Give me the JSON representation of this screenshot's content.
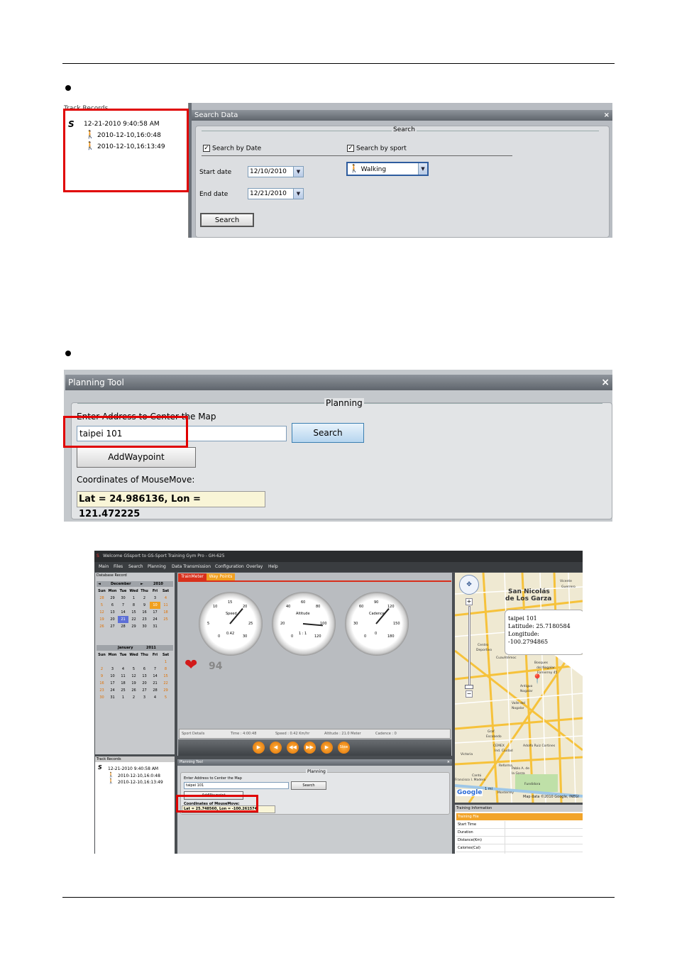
{
  "search_panel": {
    "track_records_title": "Track Records",
    "track_root": "12-21-2010 9:40:58 AM",
    "track_children": [
      "2010-12-10,16:0:48",
      "2010-12-10,16:13:49"
    ],
    "title": "Search Data",
    "close": "×",
    "group_label": "Search",
    "search_by_date": "Search by Date",
    "search_by_sport": "Search by sport",
    "start_date_label": "Start date",
    "start_date_value": "12/10/2010",
    "end_date_label": "End date",
    "end_date_value": "12/21/2010",
    "sport_value": "Walking",
    "search_button": "Search"
  },
  "planning_panel": {
    "title": "Planning Tool",
    "close": "×",
    "group_label": "Planning",
    "address_label": "Enter Address to Center the Map",
    "address_value": "taipei 101",
    "search_button": "Search",
    "add_waypoint": "AddWaypoint",
    "coords_label": "Coordinates of MouseMove:",
    "coords_value": "Lat = 24.986136, Lon = 121.472225"
  },
  "app": {
    "title": "Welcome GSsport to GS-Sport Training Gym Pro - GH-625",
    "menu": [
      "Main",
      "Files",
      "Search",
      "Planning",
      "Data Transmission",
      "Configuration",
      "Overlay",
      "Help"
    ],
    "db_record": "Database Record",
    "cal1_month": "December",
    "cal1_year": "2010",
    "cal2_month": "January",
    "cal2_year": "2011",
    "weekdays": [
      "Sun",
      "Mon",
      "Tue",
      "Wed",
      "Thu",
      "Fri",
      "Sat"
    ],
    "cal1_rows": [
      [
        "28",
        "29",
        "30",
        "1",
        "2",
        "3",
        "4"
      ],
      [
        "5",
        "6",
        "7",
        "8",
        "9",
        "10",
        "11"
      ],
      [
        "12",
        "13",
        "14",
        "15",
        "16",
        "17",
        "18"
      ],
      [
        "19",
        "20",
        "21",
        "22",
        "23",
        "24",
        "25"
      ],
      [
        "26",
        "27",
        "28",
        "29",
        "30",
        "31",
        ""
      ]
    ],
    "cal2_rows": [
      [
        "",
        "",
        "",
        "",
        "",
        "",
        "1"
      ],
      [
        "2",
        "3",
        "4",
        "5",
        "6",
        "7",
        "8"
      ],
      [
        "9",
        "10",
        "11",
        "12",
        "13",
        "14",
        "15"
      ],
      [
        "16",
        "17",
        "18",
        "19",
        "20",
        "21",
        "22"
      ],
      [
        "23",
        "24",
        "25",
        "26",
        "27",
        "28",
        "29"
      ],
      [
        "30",
        "31",
        "1",
        "2",
        "3",
        "4",
        "5"
      ]
    ],
    "tabs": [
      "TrainMeter",
      "Way Points"
    ],
    "gauges": [
      {
        "label": "Speed",
        "value": "0.42",
        "ticks": [
          "0",
          "5",
          "10",
          "15",
          "20",
          "25",
          "30"
        ]
      },
      {
        "label": "Altitude",
        "value": "1 : 1",
        "ticks": [
          "0",
          "20",
          "40",
          "60",
          "80",
          "100",
          "120"
        ]
      },
      {
        "label": "Cadence",
        "value": "0",
        "ticks": [
          "0",
          "30",
          "60",
          "90",
          "120",
          "150",
          "180"
        ]
      }
    ],
    "heart_value": "94",
    "status": [
      "Sport Details",
      "Time : 4:00:48",
      "Speed : 0.42 Km/hr",
      "Altitude : 21.0 Meter",
      "Cadence : 0"
    ],
    "slow_btn": "Slow",
    "track_records": "Track Records",
    "track_root": "12-21-2010 9:40:58 AM",
    "track_children": [
      "2010-12-10,16:0:48",
      "2010-12-10,16:13:49"
    ],
    "plan_title": "Planning Tool",
    "plan_group": "Planning",
    "plan_address_label": "Enter Address to Center the Map",
    "plan_address": "taipei 101",
    "plan_search": "Search",
    "plan_add": "AddWaypoint",
    "plan_coords_label": "Coordinates of MouseMove:",
    "plan_coords": "Lat = 25.748560, Lon = -100.261574",
    "map": {
      "city": "San Nicolás",
      "city2": "de Los Garza",
      "info_title": "taipei 101",
      "info_lat": "Latitude: 25.7180584",
      "info_lon": "Longitude: -100.2794865",
      "labels": [
        "Vicente",
        "Guerrero",
        "Centro",
        "Deportivo",
        "Cuauhtémoc",
        "Bosques",
        "del Nogalar",
        "Fomerrey 45",
        "Antiguo",
        "Nogalar",
        "Valle del",
        "Nogalar",
        "Graf.",
        "Escobedo",
        "CEMEX",
        "Ind. Ciudad",
        "Adolfo Ruiz Cortines",
        "Victoria",
        "Reforma",
        "Cantú",
        "Pablo A. de",
        "la Garza",
        "Francisco I. Madero",
        "Fundidora",
        "Monterrey"
      ],
      "scale": "1 mi",
      "copyright": "Map data ©2010 Google, INEGI",
      "google": "Google"
    },
    "training_info": "Training Information",
    "training_file": "Training File",
    "training_rows": [
      "Start Time",
      "Duration",
      "Distance(Km)",
      "Calories(Cal)"
    ]
  },
  "colors": {
    "red_box": "#e00000",
    "tab_orange": "#f0a020",
    "accent_blue": "#2e5c9e"
  }
}
